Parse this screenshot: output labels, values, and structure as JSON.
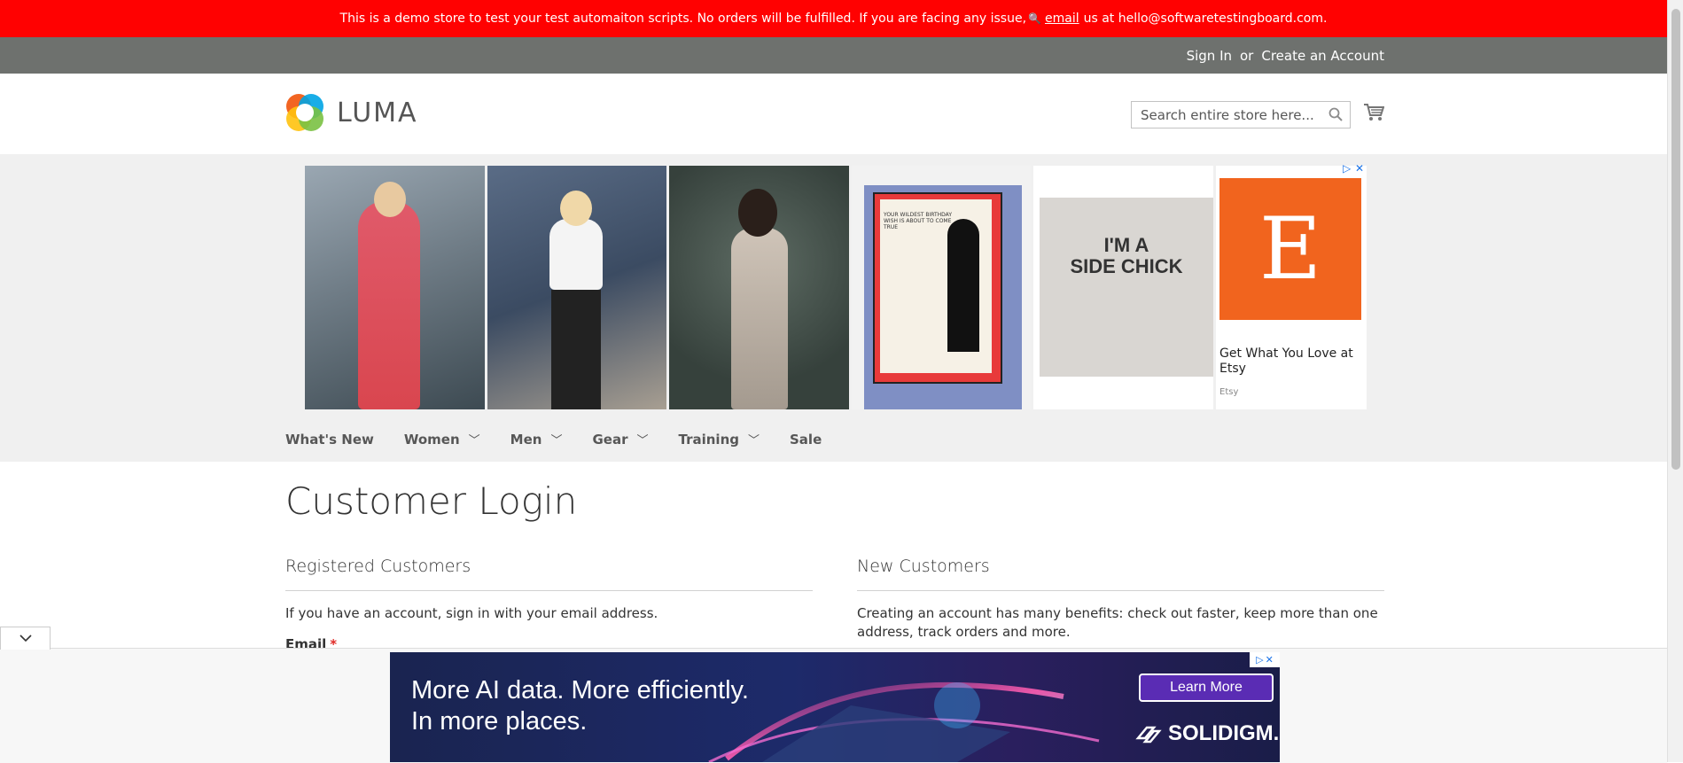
{
  "demo_notice": {
    "text_before": "This is a demo store to test your test automaiton scripts. No orders will be fulfilled. If you are facing any issue,",
    "icon": "key-icon",
    "link_text": "email",
    "text_after": "us at hello@softwaretestingboard.com."
  },
  "panel_header": {
    "sign_in": "Sign In",
    "or": "or",
    "create_account": "Create an Account"
  },
  "header": {
    "logo_text": "LUMA",
    "search_placeholder": "Search entire store here...",
    "cart_icon": "cart-icon"
  },
  "ad_banner": {
    "etsy_title": "Get What You Love at Etsy",
    "etsy_brand": "Etsy",
    "etsy_letter": "E",
    "tile4_caption": "YOUR WILDEST BIRTHDAY WISH IS ABOUT TO COME TRUE",
    "tile5_text_line1": "I'M A",
    "tile5_text_line2": "SIDE CHICK"
  },
  "nav": {
    "items": [
      {
        "label": "What's New",
        "has_children": false
      },
      {
        "label": "Women",
        "has_children": true
      },
      {
        "label": "Men",
        "has_children": true
      },
      {
        "label": "Gear",
        "has_children": true
      },
      {
        "label": "Training",
        "has_children": true
      },
      {
        "label": "Sale",
        "has_children": false
      }
    ]
  },
  "page": {
    "title": "Customer Login",
    "registered": {
      "title": "Registered Customers",
      "text": "If you have an account, sign in with your email address.",
      "email_label": "Email",
      "required_mark": "*"
    },
    "new_customers": {
      "title": "New Customers",
      "text": "Creating an account has many benefits: check out faster, keep more than one address, track orders and more."
    }
  },
  "bottom_ad": {
    "headline_line1": "More AI data. More efficiently.",
    "headline_line2": "In more places.",
    "cta": "Learn More",
    "brand": "SOLIDIGM."
  },
  "colors": {
    "demo_bar": "#ff0101",
    "panel_header": "#6e716e",
    "etsy_orange": "#f1641e",
    "required": "#e02b27"
  }
}
